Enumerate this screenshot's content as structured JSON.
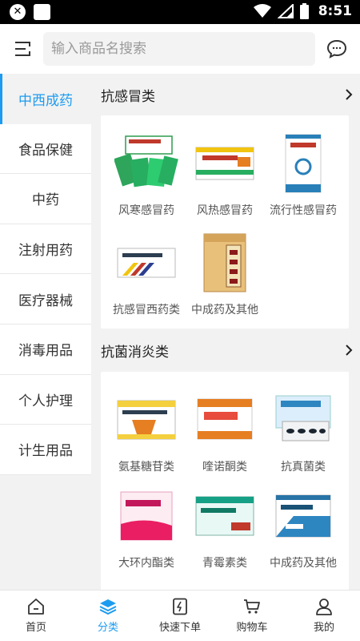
{
  "status_bar": {
    "time": "8:51",
    "shield_glyph": "✕"
  },
  "header": {
    "search_placeholder": "输入商品名搜索"
  },
  "sidebar": {
    "items": [
      {
        "label": "中西成药",
        "active": true
      },
      {
        "label": "食品保健"
      },
      {
        "label": "中药"
      },
      {
        "label": "注射用药"
      },
      {
        "label": "医疗器械"
      },
      {
        "label": "消毒用品"
      },
      {
        "label": "个人护理"
      },
      {
        "label": "计生用品"
      }
    ]
  },
  "sections": [
    {
      "title": "抗感冒类",
      "products": [
        {
          "label": "风寒感冒药"
        },
        {
          "label": "风热感冒药"
        },
        {
          "label": "流行性感冒药"
        },
        {
          "label": "抗感冒西药类"
        },
        {
          "label": "中成药及其他"
        }
      ]
    },
    {
      "title": "抗菌消炎类",
      "products": [
        {
          "label": "氨基糖苷类"
        },
        {
          "label": "喹诺酮类"
        },
        {
          "label": "抗真菌类"
        },
        {
          "label": "大环内酯类"
        },
        {
          "label": "青霉素类"
        },
        {
          "label": "中成药及其他"
        }
      ]
    }
  ],
  "bottom_nav": {
    "items": [
      {
        "label": "首页",
        "icon": "home-icon"
      },
      {
        "label": "分类",
        "icon": "category-layers-icon",
        "active": true
      },
      {
        "label": "快速下单",
        "icon": "quick-order-icon"
      },
      {
        "label": "购物车",
        "icon": "cart-icon"
      },
      {
        "label": "我的",
        "icon": "profile-icon"
      }
    ]
  },
  "colors": {
    "accent": "#1d9bf0",
    "background": "#f2f2f2"
  }
}
